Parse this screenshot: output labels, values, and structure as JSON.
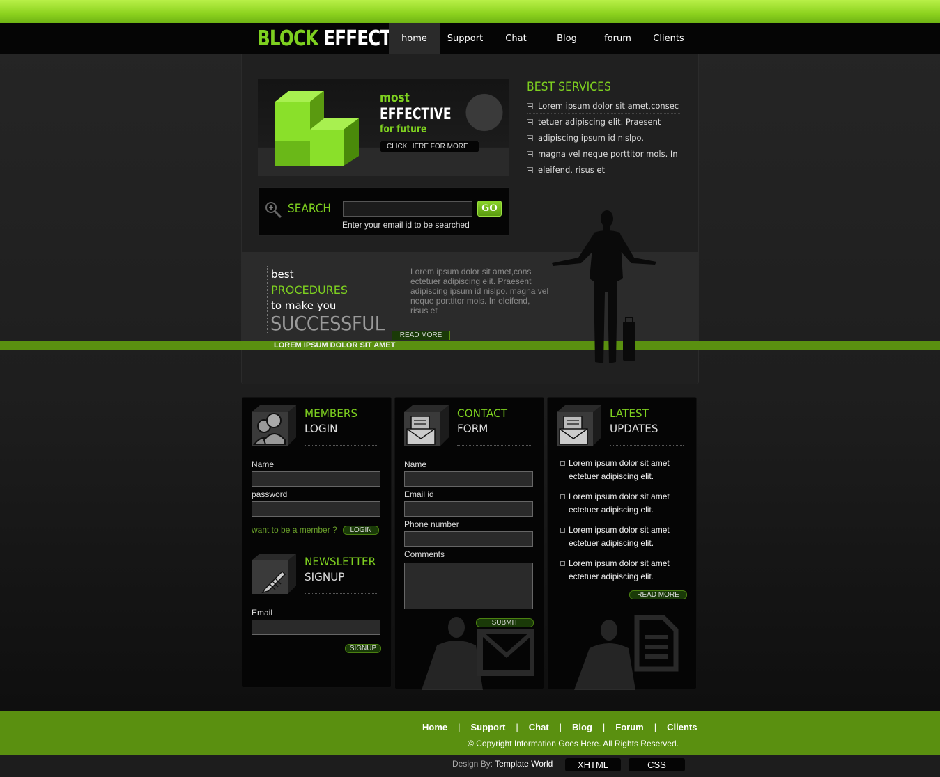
{
  "logo": {
    "part1": "BLOCK",
    "part2": "EFFECT"
  },
  "nav": {
    "home": "home",
    "support": "Support",
    "chat": "Chat",
    "blog": "Blog",
    "forum": "forum",
    "clients": "Clients"
  },
  "banner": {
    "line1": "most",
    "line2": "EFFECTIVE",
    "line3": "for future",
    "button": "CLICK HERE FOR MORE"
  },
  "search": {
    "label": "SEARCH",
    "value": "",
    "go": "GO",
    "hint": "Enter your email id to be searched"
  },
  "services": {
    "title": "BEST SERVICES",
    "items": [
      "Lorem ipsum dolor sit amet,consec",
      "tetuer adipiscing elit. Praesent",
      "adipiscing ipsum id nislpo.",
      "magna vel neque porttitor mols. In",
      "eleifend, risus et"
    ]
  },
  "procedures": {
    "best": "best",
    "procedures": "PROCEDURES",
    "to_make": "to make you",
    "successful": "SUCCESSFUL",
    "text": "Lorem ipsum dolor sit amet,cons ectetuer adipiscing elit. Praesent adipiscing ipsum id nislpo. magna vel neque porttitor mols. In eleifend, risus et",
    "read_more": "READ MORE",
    "tagline": "LOREM IPSUM DOLOR SIT AMET"
  },
  "members": {
    "title1": "MEMBERS",
    "title2": "LOGIN",
    "name_label": "Name",
    "name_value": "",
    "password_label": "password",
    "password_value": "",
    "question": "want to be a member ?",
    "login_button": "LOGIN"
  },
  "newsletter": {
    "title1": "NEWSLETTER",
    "title2": "SIGNUP",
    "email_label": "Email",
    "email_value": "",
    "signup_button": "SIGNUP"
  },
  "contact": {
    "title1": "CONTACT",
    "title2": "FORM",
    "name_label": "Name",
    "email_label": "Email id",
    "phone_label": "Phone number",
    "comments_label": "Comments",
    "name_value": "",
    "email_value": "",
    "phone_value": "",
    "comments_value": "",
    "submit_button": "SUBMIT"
  },
  "updates": {
    "title1": "LATEST",
    "title2": "UPDATES",
    "items": [
      {
        "line1": "Lorem ipsum dolor sit amet",
        "line2": "ectetuer adipiscing elit."
      },
      {
        "line1": "Lorem ipsum dolor sit amet",
        "line2": "ectetuer adipiscing elit."
      },
      {
        "line1": "Lorem ipsum dolor sit amet",
        "line2": "ectetuer adipiscing elit."
      },
      {
        "line1": "Lorem ipsum dolor sit amet",
        "line2": "ectetuer adipiscing elit."
      }
    ],
    "read_more": "READ MORE"
  },
  "footer": {
    "links": [
      "Home",
      "Support",
      "Chat",
      "Blog",
      "Forum",
      "Clients"
    ],
    "separator": "|",
    "copyright": "© Copyright Information Goes Here. All Rights Reserved.",
    "design_by_label": "Design By:",
    "design_by_name": "Template World",
    "xhtml": "XHTML",
    "css": "CSS"
  },
  "colors": {
    "accent": "#7ed020",
    "footer_green": "#5a9010",
    "top_bar": "#9ae030"
  }
}
